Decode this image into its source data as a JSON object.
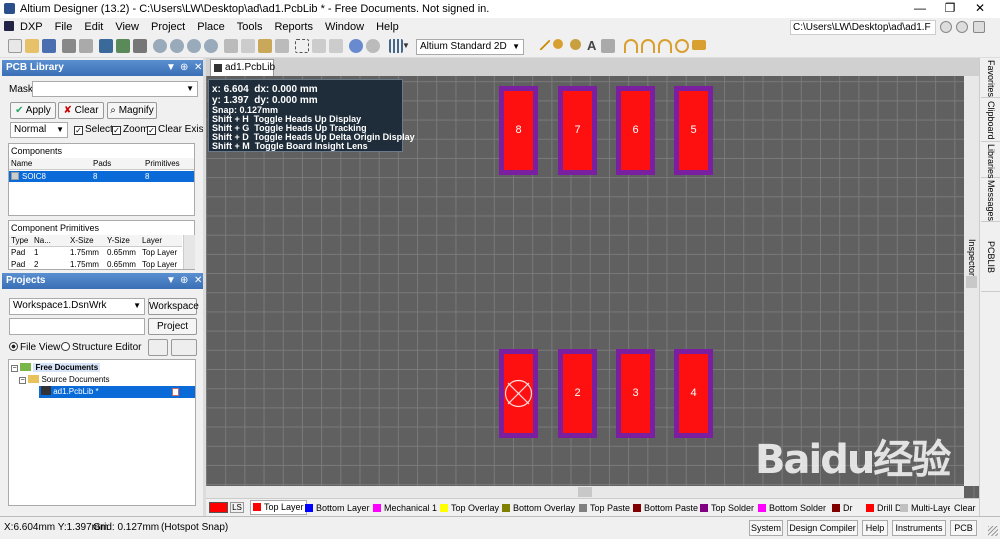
{
  "window": {
    "title": "Altium Designer (13.2) - C:\\Users\\LW\\Desktop\\ad\\ad1.PcbLib * - Free Documents. Not signed in.",
    "minimize": "—",
    "maximize": "❐",
    "close": "✕"
  },
  "menu": [
    "DXP",
    "File",
    "Edit",
    "View",
    "Project",
    "Place",
    "Tools",
    "Reports",
    "Window",
    "Help"
  ],
  "path": "C:\\Users\\LW\\Desktop\\ad\\ad1.F",
  "toolbar": {
    "view_mode": "Altium Standard 2D",
    "text_tool": "A"
  },
  "pcb_library": {
    "title": "PCB Library",
    "mask_label": "Mask",
    "apply": "Apply",
    "clear": "Clear",
    "magnify": "Magnify",
    "mode": "Normal",
    "select": "Select",
    "zoom": "Zoom",
    "clear_existing": "Clear Existin",
    "components_label": "Components",
    "comp_headers": [
      "Name",
      "Pads",
      "Primitives"
    ],
    "components": [
      {
        "name": "SOIC8",
        "pads": "8",
        "primitives": "8"
      }
    ],
    "prims_label": "Component Primitives",
    "prim_headers": [
      "Type",
      "Na...",
      "X-Size",
      "Y-Size",
      "Layer"
    ],
    "primitives": [
      {
        "type": "Pad",
        "name": "1",
        "x": "1.75mm",
        "y": "0.65mm",
        "layer": "Top Layer"
      },
      {
        "type": "Pad",
        "name": "2",
        "x": "1.75mm",
        "y": "0.65mm",
        "layer": "Top Layer"
      }
    ]
  },
  "projects": {
    "title": "Projects",
    "workspace": "Workspace1.DsnWrk",
    "workspace_btn": "Workspace",
    "project_btn": "Project",
    "file_view": "File View",
    "structure_editor": "Structure Editor",
    "tree": [
      "Free Documents",
      "Source Documents",
      "ad1.PcbLib *"
    ]
  },
  "doc_tab": "ad1.PcbLib *",
  "hud": {
    "l1": "x: 6.604  dx: 0.000 mm",
    "l2": "y: 1.397  dy: 0.000 mm",
    "l3": "Snap: 0.127mm",
    "l4": "Shift + H  Toggle Heads Up Display",
    "l5": "Shift + G  Toggle Heads Up Tracking",
    "l6": "Shift + D  Toggle Heads Up Delta Origin Display",
    "l7": "Shift + M  Toggle Board Insight Lens"
  },
  "pads_top": [
    "8",
    "7",
    "6",
    "5"
  ],
  "pads_bottom": [
    "",
    "2",
    "3",
    "4"
  ],
  "right_tabs": [
    "Favorites",
    "Clipboard",
    "Libraries",
    "Messages",
    "PCBLIB Inspector"
  ],
  "layers": [
    {
      "name": "LS",
      "color": "#ff0000"
    },
    {
      "name": "Top Layer",
      "color": "#ff0000"
    },
    {
      "name": "Bottom Layer",
      "color": "#0000ff"
    },
    {
      "name": "Mechanical 1",
      "color": "#ff00ff"
    },
    {
      "name": "Top Overlay",
      "color": "#ffff00"
    },
    {
      "name": "Bottom Overlay",
      "color": "#808000"
    },
    {
      "name": "Top Paste",
      "color": "#808080"
    },
    {
      "name": "Bottom Paste",
      "color": "#800000"
    },
    {
      "name": "Top Solder",
      "color": "#800080"
    },
    {
      "name": "Bottom Solder",
      "color": "#ff00ff"
    },
    {
      "name": "Dr",
      "color": "#800000"
    },
    {
      "name": "Drill Drawing",
      "color": "#ff0000"
    },
    {
      "name": "Multi-Layer",
      "color": "#c0c0c0"
    }
  ],
  "layer_clear": "Clear",
  "status": {
    "coords": "X:6.604mm Y:1.397mm",
    "grid": "Grid: 0.127mm",
    "snap": "(Hotspot Snap)",
    "buttons": [
      "System",
      "Design Compiler",
      "Help",
      "Instruments",
      "PCB"
    ]
  },
  "watermark": "Baidu经验"
}
